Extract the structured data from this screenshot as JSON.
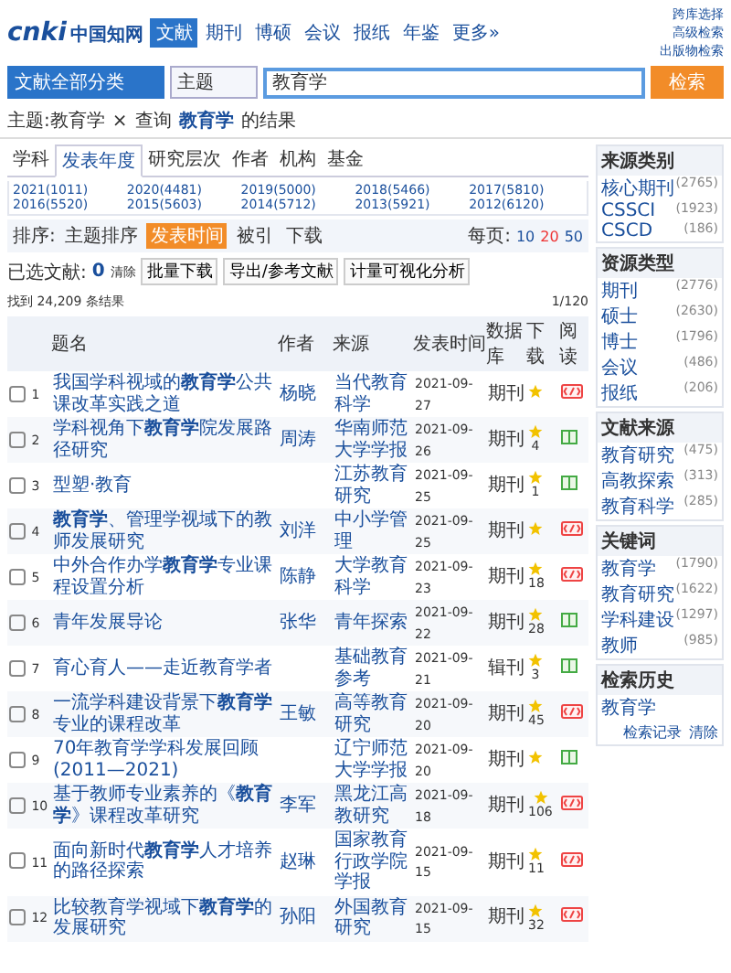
{
  "header": {
    "logo_latin": "cnki",
    "logo_cn": "中国知网",
    "nav": [
      {
        "label": "文献",
        "selected": true
      },
      {
        "label": "期刊",
        "selected": false
      },
      {
        "label": "博硕",
        "selected": false
      },
      {
        "label": "会议",
        "selected": false
      },
      {
        "label": "报纸",
        "selected": false
      },
      {
        "label": "年鉴",
        "selected": false
      },
      {
        "label": "更多»",
        "selected": false
      }
    ],
    "links": [
      "跨库选择",
      "高级检索",
      "出版物检索"
    ]
  },
  "search": {
    "scope": "文献全部分类",
    "field": "主题",
    "value": "教育学",
    "button": "检索"
  },
  "breadcrumb": {
    "filter": "主题:教育学",
    "remove": "×",
    "prefix": "查询",
    "term": "教育学",
    "suffix": "的结果"
  },
  "group_tabs": [
    {
      "label": "学科",
      "selected": false
    },
    {
      "label": "发表年度",
      "selected": true
    },
    {
      "label": "研究层次",
      "selected": false
    },
    {
      "label": "作者",
      "selected": false
    },
    {
      "label": "机构",
      "selected": false
    },
    {
      "label": "基金",
      "selected": false
    }
  ],
  "years": [
    "2021(1011)",
    "2020(4481)",
    "2019(5000)",
    "2018(5466)",
    "2017(5810)",
    "2016(5520)",
    "2015(5603)",
    "2014(5712)",
    "2013(5921)",
    "2012(6120)"
  ],
  "sort": {
    "label": "排序:",
    "options": [
      {
        "label": "主题排序",
        "selected": false
      },
      {
        "label": "发表时间",
        "selected": true
      },
      {
        "label": "被引",
        "selected": false
      },
      {
        "label": "下载",
        "selected": false
      }
    ],
    "per_page_label": "每页:",
    "per_page": [
      {
        "label": "10",
        "selected": false
      },
      {
        "label": "20",
        "selected": true
      },
      {
        "label": "50",
        "selected": false
      }
    ]
  },
  "toolbar": {
    "selected_label": "已选文献:",
    "selected_count": "0",
    "clear": "清除",
    "buttons": [
      "批量下载",
      "导出/参考文献",
      "计量可视化分析"
    ],
    "found": "找到 24,209 条结果",
    "pages": "1/120"
  },
  "table": {
    "columns": [
      "题名",
      "作者",
      "来源",
      "发表时间",
      "数据库",
      "下载",
      "阅读"
    ],
    "rows": [
      {
        "checked": false,
        "number": "1",
        "title": "我国学科视域的**教育学**公共课改革实践之道",
        "author": "杨晓",
        "source": "当代教育科学",
        "date": "2021-09-27",
        "database": "期刊",
        "downloads": "",
        "read_icon": {
          "kind": "html"
        }
      },
      {
        "checked": false,
        "number": "2",
        "title": "学科视角下**教育学**院发展路径研究",
        "author": "周涛",
        "source": "华南师范大学学报",
        "date": "2021-09-26",
        "database": "期刊",
        "downloads": "4",
        "read_icon": {
          "kind": "book"
        }
      },
      {
        "checked": false,
        "number": "3",
        "title": "型塑·教育",
        "author": "",
        "source": "江苏教育研究",
        "date": "2021-09-25",
        "database": "期刊",
        "downloads": "1",
        "read_icon": {
          "kind": "book"
        }
      },
      {
        "checked": false,
        "number": "4",
        "title": "**教育学**、管理学视域下的教师发展研究",
        "author": "刘洋",
        "source": "中小学管理",
        "date": "2021-09-25",
        "database": "期刊",
        "downloads": "",
        "read_icon": {
          "kind": "html"
        }
      },
      {
        "checked": false,
        "number": "5",
        "title": "中外合作办学**教育学**专业课程设置分析",
        "author": "陈静",
        "source": "大学教育科学",
        "date": "2021-09-23",
        "database": "期刊",
        "downloads": "18",
        "read_icon": {
          "kind": "html"
        }
      },
      {
        "checked": false,
        "number": "6",
        "title": "青年发展导论",
        "author": "张华",
        "source": "青年探索",
        "date": "2021-09-22",
        "database": "期刊",
        "downloads": "28",
        "read_icon": {
          "kind": "book"
        }
      },
      {
        "checked": false,
        "number": "7",
        "title": "育心育人——走近教育学者",
        "author": "",
        "source": "基础教育参考",
        "date": "2021-09-21",
        "database": "辑刊",
        "downloads": "3",
        "read_icon": {
          "kind": "book"
        }
      },
      {
        "checked": false,
        "number": "8",
        "title": "一流学科建设背景下**教育学**专业的课程改革",
        "author": "王敏",
        "source": "高等教育研究",
        "date": "2021-09-20",
        "database": "期刊",
        "downloads": "45",
        "read_icon": {
          "kind": "html"
        }
      },
      {
        "checked": false,
        "number": "9",
        "title": "70年教育学学科发展回顾(2011—2021)",
        "author": "",
        "source": "辽宁师范大学学报",
        "date": "2021-09-20",
        "database": "期刊",
        "downloads": "",
        "read_icon": {
          "kind": "book"
        }
      },
      {
        "checked": false,
        "number": "10",
        "title": "基于教师专业素养的《**教育学**》课程改革研究",
        "author": "李军",
        "source": "黑龙江高教研究",
        "date": "2021-09-18",
        "database": "期刊",
        "downloads": "106",
        "read_icon": {
          "kind": "html"
        }
      },
      {
        "checked": false,
        "number": "11",
        "title": "面向新时代**教育学**人才培养的路径探索",
        "author": "赵琳",
        "source": "国家教育行政学院学报",
        "date": "2021-09-15",
        "database": "期刊",
        "downloads": "11",
        "read_icon": {
          "kind": "html"
        }
      },
      {
        "checked": false,
        "number": "12",
        "title": "比较教育学视域下**教育学**的发展研究",
        "author": "孙阳",
        "source": "外国教育研究",
        "date": "2021-09-15",
        "database": "期刊",
        "downloads": "32",
        "read_icon": {
          "kind": "html"
        }
      }
    ]
  },
  "sidebar": [
    {
      "title": "来源类别",
      "items": [
        {
          "name": "核心期刊",
          "count": "(2765)"
        },
        {
          "name": "CSSCI",
          "count": "(1923)"
        },
        {
          "name": "CSCD",
          "count": "(186)"
        }
      ]
    },
    {
      "title": "资源类型",
      "items": [
        {
          "name": "期刊",
          "count": "(2776)"
        },
        {
          "name": "硕士",
          "count": "(2630)"
        },
        {
          "name": "博士",
          "count": "(1796)"
        },
        {
          "name": "会议",
          "count": "(486)"
        },
        {
          "name": "报纸",
          "count": "(206)"
        }
      ]
    },
    {
      "title": "文献来源",
      "items": [
        {
          "name": "教育研究",
          "count": "(475)"
        },
        {
          "name": "高教探索",
          "count": "(313)"
        },
        {
          "name": "教育科学",
          "count": "(285)"
        }
      ]
    },
    {
      "title": "关键词",
      "items": [
        {
          "name": "教育学",
          "count": "(1790)"
        },
        {
          "name": "教育研究",
          "count": "(1622)"
        },
        {
          "name": "学科建设",
          "count": "(1297)"
        },
        {
          "name": "教师",
          "count": "(985)"
        }
      ]
    }
  ],
  "history": {
    "title": "检索历史",
    "items": [
      "教育学"
    ],
    "actions": [
      "检索记录",
      "清除"
    ]
  }
}
